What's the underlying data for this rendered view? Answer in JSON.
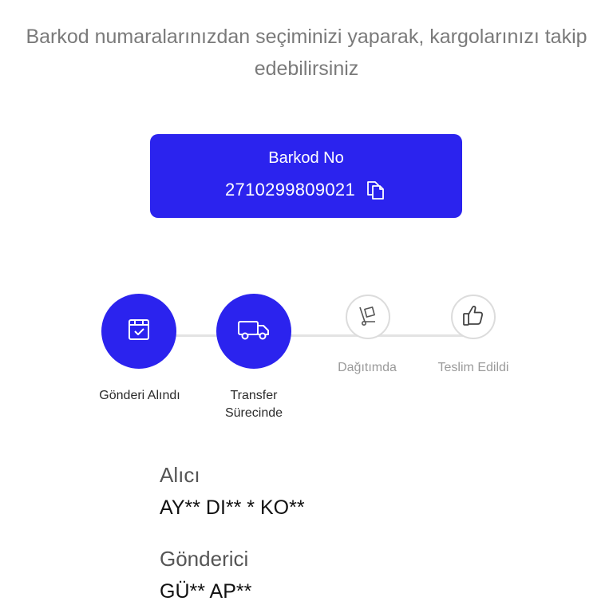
{
  "header": {
    "subtitle": "Barkod numaralarınızdan seçiminizi yaparak, kargolarınızı takip edebilirsiniz"
  },
  "barcode": {
    "label": "Barkod No",
    "value": "2710299809021",
    "icon": "copy-icon"
  },
  "accent_color": "#2b23ee",
  "steps": [
    {
      "label": "Gönderi Alındı",
      "icon": "box-check-icon",
      "active": true
    },
    {
      "label": "Transfer Sürecinde",
      "label_line1": "Transfer",
      "label_line2": "Sürecinde",
      "icon": "truck-icon",
      "active": true
    },
    {
      "label": "Dağıtımda",
      "icon": "hand-truck-icon",
      "active": false
    },
    {
      "label": "Teslim Edildi",
      "icon": "thumbs-up-icon",
      "active": false
    }
  ],
  "recipient": {
    "title": "Alıcı",
    "name": "AY** DI** * KO**"
  },
  "sender": {
    "title": "Gönderici",
    "name": "GÜ** AP**"
  }
}
